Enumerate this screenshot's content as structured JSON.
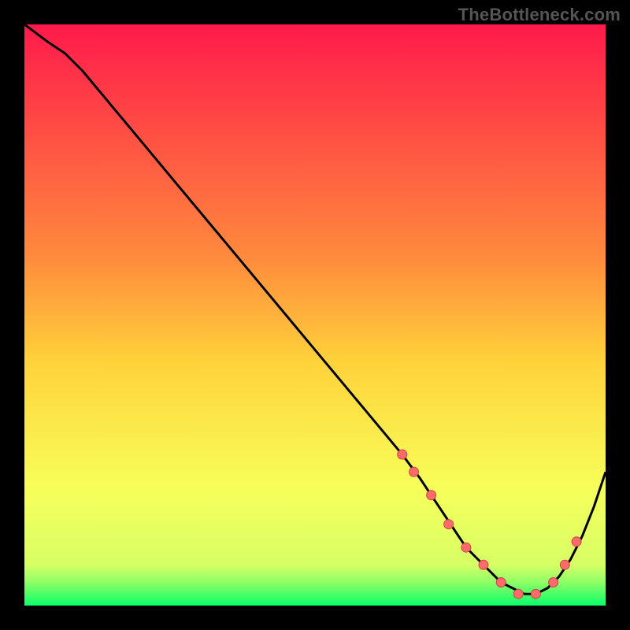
{
  "watermark": "TheBottleneck.com",
  "colors": {
    "frame_bg": "#000000",
    "grad_top": "#ff1a4b",
    "grad_mid": "#ffd23a",
    "grad_low": "#f7ff5a",
    "grad_bottom": "#0aff6a",
    "curve": "#000000",
    "marker_fill": "#ff6b6b",
    "marker_stroke": "#c74545"
  },
  "chart_data": {
    "type": "line",
    "title": "",
    "xlabel": "",
    "ylabel": "",
    "xlim": [
      0,
      100
    ],
    "ylim": [
      0,
      100
    ],
    "x": [
      0,
      4,
      7,
      10,
      15,
      20,
      25,
      30,
      35,
      40,
      45,
      50,
      55,
      60,
      65,
      68,
      70,
      72,
      74,
      76,
      78,
      80,
      82,
      84,
      86,
      88,
      90,
      92,
      94,
      96,
      98,
      100
    ],
    "values": [
      100,
      97,
      95,
      92,
      86,
      80,
      74,
      68,
      62,
      56,
      50,
      44,
      38,
      32,
      26,
      22,
      19,
      16,
      13,
      10,
      8,
      6,
      4,
      3,
      2,
      2,
      3,
      5,
      8,
      12,
      17,
      23
    ],
    "markers_x": [
      65,
      67,
      70,
      73,
      76,
      79,
      82,
      85,
      88,
      91,
      93,
      95
    ],
    "markers_y": [
      26,
      23,
      19,
      14,
      10,
      7,
      4,
      2,
      2,
      4,
      7,
      11
    ]
  }
}
